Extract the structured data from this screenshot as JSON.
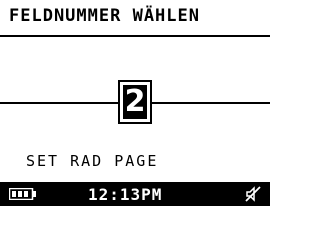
{
  "screen": {
    "title": "FELDNUMMER WÄHLEN",
    "field_number": "2",
    "softkey_label": "SET RAD PAGE"
  },
  "status_bar": {
    "battery_icon": "battery-icon",
    "battery_level": 1.0,
    "time": "12:13PM",
    "sound_icon": "speaker-muted-icon"
  },
  "colors": {
    "background": "#ffffff",
    "foreground": "#000000"
  }
}
